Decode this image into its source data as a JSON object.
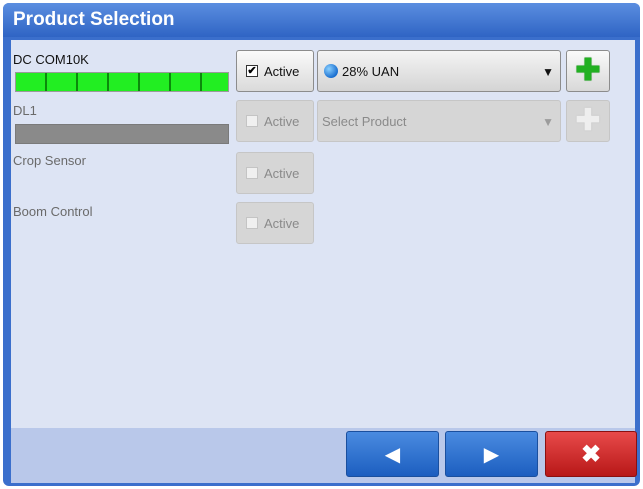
{
  "window": {
    "title": "Product Selection"
  },
  "channels": [
    {
      "name": "DC COM10K",
      "status": "connected",
      "status_color": "#22ee22",
      "active_label": "Active",
      "active_checked": true,
      "product": "28% UAN",
      "product_icon": "droplet-icon",
      "add_icon": "plus-icon",
      "enabled": true
    },
    {
      "name": "DL1",
      "status": "disconnected",
      "status_color": "#8a8a8a",
      "active_label": "Active",
      "active_checked": false,
      "product": "Select Product",
      "add_icon": "plus-icon",
      "enabled": false
    },
    {
      "name": "Crop Sensor",
      "active_label": "Active",
      "active_checked": false,
      "enabled": false
    },
    {
      "name": "Boom Control",
      "active_label": "Active",
      "active_checked": false,
      "enabled": false
    }
  ],
  "footer": {
    "prev_icon": "arrow-left-icon",
    "next_icon": "arrow-right-icon",
    "cancel_icon": "close-icon",
    "prev_glyph": "◀",
    "next_glyph": "▶",
    "cancel_glyph": "✖"
  },
  "glyphs": {
    "check": "✔",
    "caret": "▼",
    "plus": "✚"
  },
  "colors": {
    "title_bar": "#3b6fcc",
    "content_bg": "#dde4f4",
    "nav_blue": "#1c5ec0",
    "cancel_red": "#c82020",
    "add_green": "#22b022"
  }
}
